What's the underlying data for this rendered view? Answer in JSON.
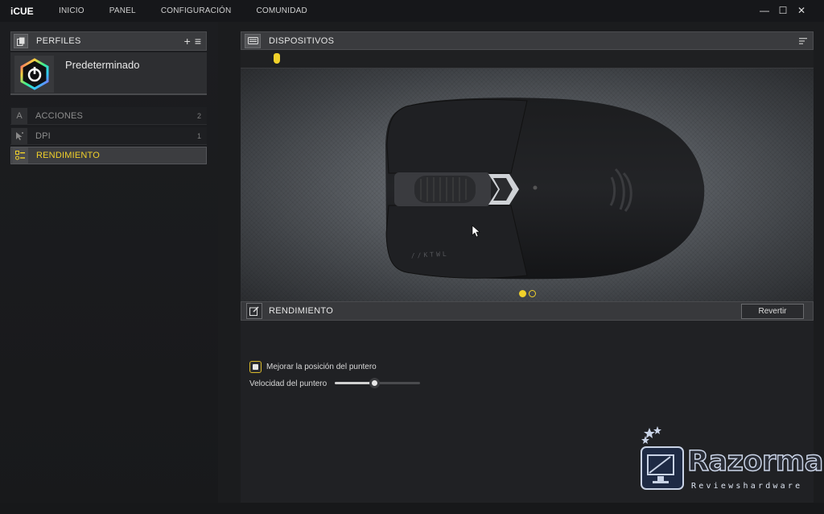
{
  "app": {
    "name": "iCUE"
  },
  "nav": {
    "items": [
      "INICIO",
      "PANEL",
      "CONFIGURACIÓN",
      "COMUNIDAD"
    ]
  },
  "window": {
    "minimize": "—",
    "maximize": "☐",
    "close": "✕"
  },
  "profiles": {
    "title": "PERFILES",
    "add_icon": "plus-icon",
    "menu_icon": "hamburger-icon",
    "current": "Predeterminado"
  },
  "sidebar": {
    "items": [
      {
        "label": "ACCIONES",
        "count": "2",
        "icon": "A",
        "active": false
      },
      {
        "label": "DPI",
        "count": "1",
        "icon": "cursor-icon",
        "active": false
      },
      {
        "label": "RENDIMIENTO",
        "count": "",
        "icon": "settings-list-icon",
        "active": true
      }
    ]
  },
  "devices": {
    "title": "DISPOSITIVOS",
    "selected_device_color": "#f1d12a"
  },
  "device_view": {
    "model_text": "//KTWL",
    "pages": 2,
    "current_page": 1
  },
  "performance": {
    "title": "RENDIMIENTO",
    "revert_label": "Revertir",
    "pointer_precision_label": "Mejorar la posición del puntero",
    "pointer_precision_checked": true,
    "pointer_speed_label": "Velocidad del puntero",
    "pointer_speed_value": 0.47
  },
  "watermark": {
    "brand": "Razorman",
    "sub": "Reviewshardware"
  },
  "colors": {
    "accent": "#f1d12a",
    "panel": "#3a3b3e",
    "bg": "#1b1c1e"
  }
}
